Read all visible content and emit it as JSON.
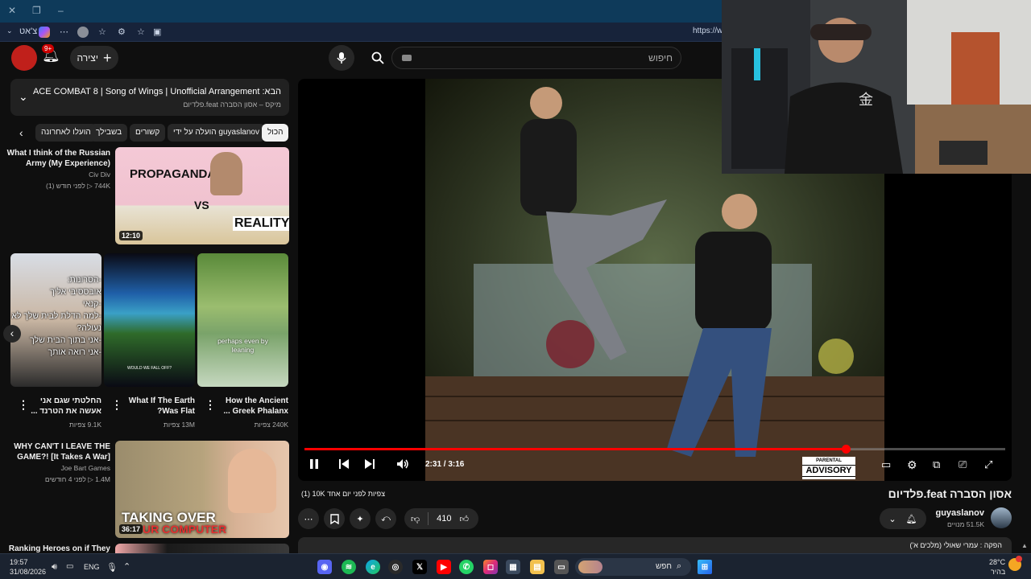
{
  "browser": {
    "chat_label": "צ'אט",
    "url_prefix": "https://w"
  },
  "header": {
    "notification_badge": "9+",
    "create_label": "יצירה",
    "search_placeholder": "חיפוש"
  },
  "playlist": {
    "title": "הבא: ACE COMBAT 8 | Song of Wings | Unofficial Arrangement",
    "subtitle": "מיקס – אסון הסברה feat.פלדיום"
  },
  "chips": [
    "הכול",
    "הועלה על ידי guyaslanov",
    "קשורים",
    "בשבילך",
    "הועלו לאחרונה"
  ],
  "recommendations": {
    "first": {
      "title_lines": [
        "What I think of the Russian",
        "Army (My Experience)"
      ],
      "channel": "Civ Div",
      "meta": "744K ▷ לפני חודש (1)",
      "duration": "12:10",
      "thumb_text_top": "PROPAGANDA",
      "thumb_text_mid": "VS",
      "thumb_text_bottom": "REALITY"
    },
    "shorts": [
      {
        "title_lines": [
          "החלטתי שגם אני",
          "אעשה את הטרנד ..."
        ],
        "views": "9.1K צפיות",
        "overlay_lines": [
          "-הסרונות:",
          "אובססיבי אליך",
          "-קנאי",
          "-למה הדלת לבית שלך לא",
          "נעולה?",
          "-אני בתוך הבית שלך",
          "-אני רואה אותך"
        ]
      },
      {
        "title_lines": [
          "What If The Earth",
          "?Was Flat"
        ],
        "views": "13M צפיות",
        "overlay_lines": [
          "WOULD WE FALL OFF?"
        ]
      },
      {
        "title_lines": [
          "How the Ancient",
          "... Greek Phalanx"
        ],
        "views": "240K צפיות",
        "overlay_lines": [
          "perhaps even by",
          "leaning"
        ]
      }
    ],
    "second": {
      "title_lines": [
        "WHY CAN'T I LEAVE THE",
        "GAME?! [It Takes A War]"
      ],
      "channel": "Joe Bart Games",
      "meta": "1.4M ▷ לפני 4 חודשים",
      "duration": "36:17",
      "thumb_text_top": "TAKING OVER",
      "thumb_text_bottom": "UR COMPUTER"
    },
    "third": {
      "title_lines": [
        "Ranking Heroes on if They"
      ]
    }
  },
  "player": {
    "time": "2:31 / 3:16",
    "progress": 0.772,
    "advisory_top": "PARENTAL",
    "advisory_main": "ADVISORY"
  },
  "video": {
    "title": "אסון הסברה feat.פלדיום",
    "stats": "(1) 10K צפיות לפני יום אחד",
    "likes": "410",
    "channel_name": "guyaslanov",
    "channel_subs": "51.5K מנויים",
    "description": "הפקה : עמרי שאולי (מלכים א')"
  },
  "taskbar": {
    "time": "19:57",
    "date": "31/08/2026",
    "lang": "ENG",
    "search_label": "חפש",
    "weather_temp": "28°C",
    "weather_desc": "בהיר"
  },
  "colors": {
    "accent": "#ff0000",
    "background": "#0f0f0f",
    "chip_bg": "#272727"
  }
}
